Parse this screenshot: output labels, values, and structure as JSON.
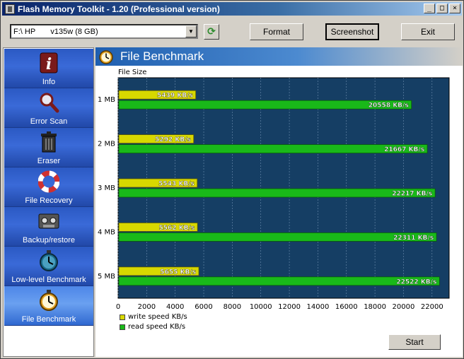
{
  "window": {
    "title": "Flash Memory Toolkit - 1.20 (Professional version)"
  },
  "toolbar": {
    "drive": "F:\\ HP       v135w (8 GB)",
    "format_label": "Format",
    "screenshot_label": "Screenshot",
    "exit_label": "Exit"
  },
  "sidebar": {
    "items": [
      {
        "label": "Info",
        "icon": "info-icon"
      },
      {
        "label": "Error Scan",
        "icon": "magnifier-icon"
      },
      {
        "label": "Eraser",
        "icon": "trash-icon"
      },
      {
        "label": "File Recovery",
        "icon": "lifebuoy-icon"
      },
      {
        "label": "Backup/restore",
        "icon": "tape-icon"
      },
      {
        "label": "Low-level Benchmark",
        "icon": "stopwatch-icon"
      },
      {
        "label": "File Benchmark",
        "icon": "stopwatch-icon"
      }
    ]
  },
  "header": {
    "title": "File Benchmark"
  },
  "start_label": "Start",
  "colors": {
    "write": "#d8d800",
    "read": "#19b919",
    "plot_bg": "#153e64"
  },
  "chart_data": {
    "type": "bar",
    "orientation": "horizontal",
    "ylabel": "File Size",
    "categories": [
      "1 MB",
      "2 MB",
      "3 MB",
      "4 MB",
      "5 MB"
    ],
    "series": [
      {
        "name": "write speed KB/s",
        "values": [
          5439,
          5292,
          5543,
          5562,
          5655
        ],
        "labels": [
          "5439 KB/s",
          "5292 KB/s",
          "5543 KB/s",
          "5562 KB/s",
          "5655 KB/s"
        ]
      },
      {
        "name": "read speed KB/s",
        "values": [
          20558,
          21667,
          22217,
          22311,
          22522
        ],
        "labels": [
          "20558 KB/s",
          "21667 KB/s",
          "22217 KB/s",
          "22311 KB/s",
          "22522 KB/s"
        ]
      }
    ],
    "xticks": [
      "0",
      "2000",
      "4000",
      "6000",
      "8000",
      "10000",
      "12000",
      "14000",
      "16000",
      "18000",
      "20000",
      "22000"
    ],
    "xlim": [
      0,
      23200
    ],
    "legend": "bottom-left",
    "grid": true
  }
}
